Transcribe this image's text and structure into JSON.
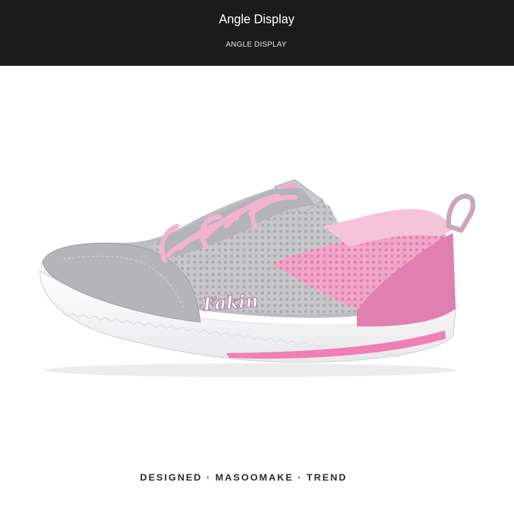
{
  "header": {
    "title": "Angle Display",
    "subtitle": "ANGLE DISPLAY"
  },
  "product": {
    "brand_script": "Fakin"
  },
  "footer": {
    "tagline": "DESIGNED · MASOOMAKE · TREND"
  },
  "colors": {
    "header_bg": "#1b1b1b",
    "shoe_gray": "#b9b9bd",
    "shoe_pink": "#e88ab8",
    "lace_pink": "#f3b9d6",
    "sole_white": "#ffffff"
  }
}
